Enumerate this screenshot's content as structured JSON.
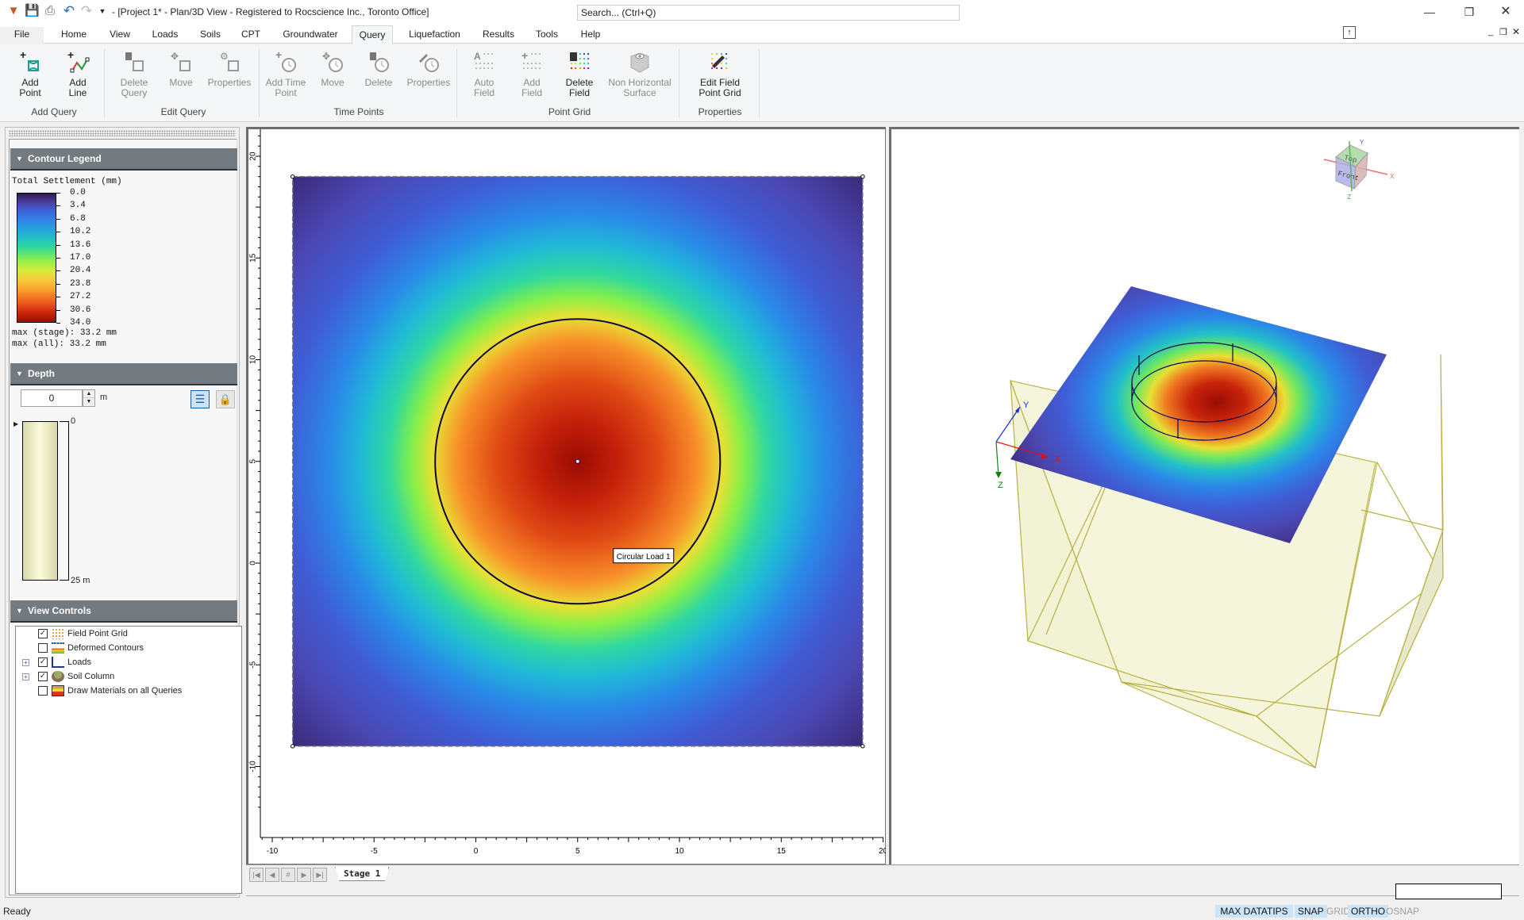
{
  "window": {
    "title": "- [Project 1* - Plan/3D View - Registered to Rocscience Inc., Toronto Office]",
    "search_placeholder": "Search... (Ctrl+Q)",
    "quick_access": [
      "app-logo-icon",
      "save-icon",
      "print-icon",
      "undo-icon",
      "redo-icon",
      "customize-icon"
    ]
  },
  "menu": {
    "tabs": [
      "File",
      "Home",
      "View",
      "Loads",
      "Soils",
      "CPT",
      "Groundwater",
      "Query",
      "Liquefaction",
      "Results",
      "Tools",
      "Help"
    ],
    "active": "Query",
    "show_classic_menus": "Show Classic Menus"
  },
  "ribbon": {
    "groups": [
      {
        "label": "Add Query",
        "buttons": [
          {
            "label1": "Add",
            "label2": "Point",
            "enabled": true
          },
          {
            "label1": "Add",
            "label2": "Line",
            "enabled": true
          }
        ]
      },
      {
        "label": "Edit Query",
        "buttons": [
          {
            "label1": "Delete",
            "label2": "Query",
            "enabled": false
          },
          {
            "label1": "Move",
            "label2": "",
            "enabled": false
          },
          {
            "label1": "Properties",
            "label2": "",
            "enabled": false
          }
        ]
      },
      {
        "label": "Time Points",
        "buttons": [
          {
            "label1": "Add Time",
            "label2": "Point",
            "enabled": false
          },
          {
            "label1": "Move",
            "label2": "",
            "enabled": false
          },
          {
            "label1": "Delete",
            "label2": "",
            "enabled": false
          },
          {
            "label1": "Properties",
            "label2": "",
            "enabled": false
          }
        ]
      },
      {
        "label": "Point Grid",
        "buttons": [
          {
            "label1": "Auto",
            "label2": "Field",
            "enabled": false
          },
          {
            "label1": "Add",
            "label2": "Field",
            "enabled": false
          },
          {
            "label1": "Delete",
            "label2": "Field",
            "enabled": true
          },
          {
            "label1": "Non Horizontal",
            "label2": "Surface",
            "enabled": false
          }
        ]
      },
      {
        "label": "Properties",
        "buttons": [
          {
            "label1": "Edit Field",
            "label2": "Point Grid",
            "enabled": true
          }
        ]
      }
    ]
  },
  "contour_legend": {
    "header": "Contour Legend",
    "title": "Total Settlement (mm)",
    "values": [
      "0.0",
      "3.4",
      "6.8",
      "10.2",
      "13.6",
      "17.0",
      "20.4",
      "23.8",
      "27.2",
      "30.6",
      "34.0"
    ],
    "max_stage": "max (stage): 33.2 mm",
    "max_all": "max (all):   33.2 mm"
  },
  "depth": {
    "header": "Depth",
    "value": "0",
    "unit": "m",
    "top_label": "0",
    "bottom_label": "25 m"
  },
  "view_controls": {
    "header": "View Controls",
    "items": [
      {
        "label": "Field Point Grid",
        "checked": true,
        "expandable": false
      },
      {
        "label": "Deformed Contours",
        "checked": false,
        "expandable": false
      },
      {
        "label": "Loads",
        "checked": true,
        "expandable": true
      },
      {
        "label": "Soil Column",
        "checked": true,
        "expandable": true
      },
      {
        "label": "Draw Materials on all Queries",
        "checked": false,
        "expandable": false
      }
    ]
  },
  "plan_view": {
    "x_ticks": [
      "-10",
      "-5",
      "0",
      "5",
      "10",
      "15",
      "20"
    ],
    "y_ticks": [
      "20",
      "15",
      "10",
      "5",
      "0",
      "-5",
      "-10"
    ],
    "load_label": "Circular Load 1",
    "load_center": [
      5,
      5
    ],
    "load_radius": 7,
    "grid_extent": {
      "xmin": -9,
      "xmax": 19,
      "ymin": -9,
      "ymax": 19
    }
  },
  "view3d": {
    "axis_labels": {
      "x": "X",
      "y": "Y",
      "z": "Z"
    },
    "cube_labels": {
      "top": "Top",
      "front": "Front"
    }
  },
  "stages": {
    "tabs": [
      "Stage 1"
    ],
    "active": "Stage 1"
  },
  "status": {
    "ready": "Ready",
    "flags": [
      {
        "label": "MAX DATATIPS",
        "on": true
      },
      {
        "label": "SNAP",
        "on": true
      },
      {
        "label": "GRID",
        "on": false
      },
      {
        "label": "ORTHO",
        "on": true
      },
      {
        "label": "OSNAP",
        "on": false
      }
    ]
  }
}
